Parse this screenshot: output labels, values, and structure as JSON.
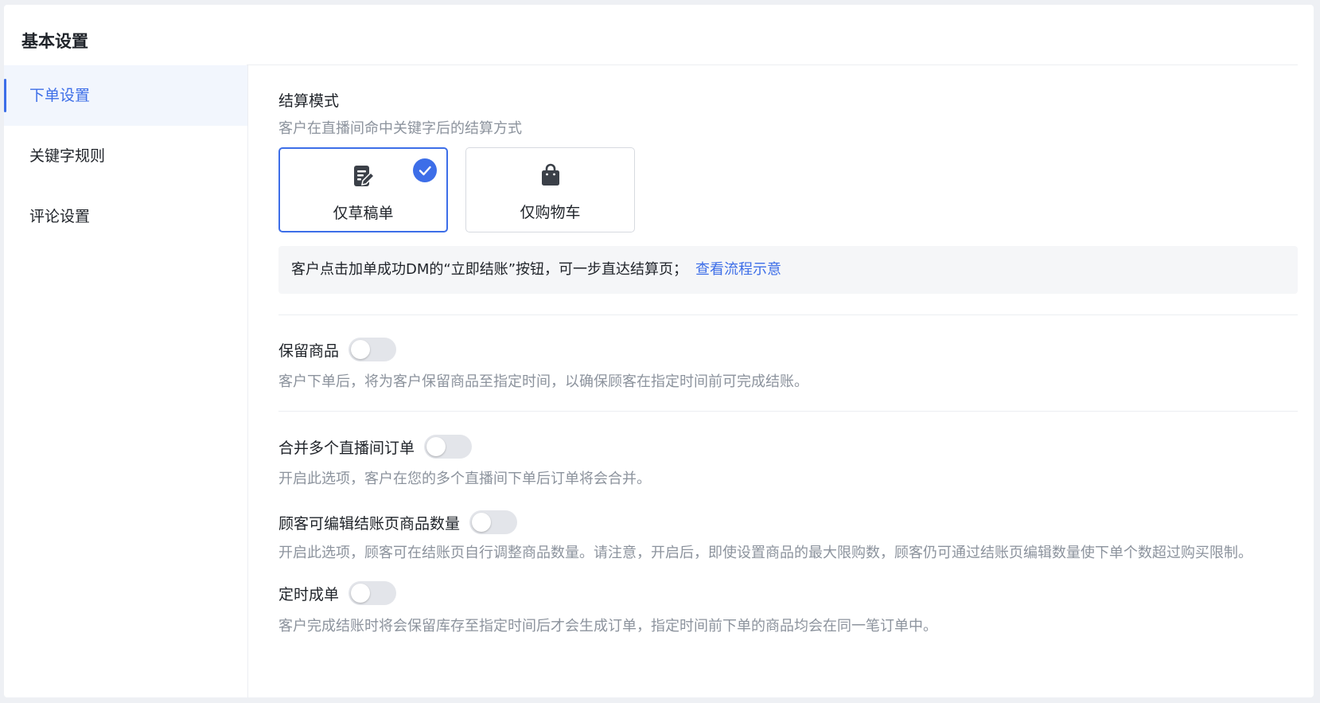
{
  "page": {
    "title": "基本设置"
  },
  "sidebar": {
    "items": [
      {
        "label": "下单设置",
        "active": true
      },
      {
        "label": "关键字规则",
        "active": false
      },
      {
        "label": "评论设置",
        "active": false
      }
    ]
  },
  "checkout_mode": {
    "title": "结算模式",
    "description": "客户在直播间命中关键字后的结算方式",
    "options": [
      {
        "label": "仅草稿单",
        "icon": "edit-document-icon",
        "selected": true
      },
      {
        "label": "仅购物车",
        "icon": "shopping-bag-icon",
        "selected": false
      }
    ],
    "info_text": "客户点击加单成功DM的“立即结账”按钮，可一步直达结算页；",
    "info_link": "查看流程示意"
  },
  "settings": [
    {
      "label": "保留商品",
      "enabled": false,
      "description": "客户下单后，将为客户保留商品至指定时间，以确保顾客在指定时间前可完成结账。"
    },
    {
      "label": "合并多个直播间订单",
      "enabled": false,
      "description": "开启此选项，客户在您的多个直播间下单后订单将会合并。"
    },
    {
      "label": "顾客可编辑结账页商品数量",
      "enabled": false,
      "description": "开启此选项，顾客可在结账页自行调整商品数量。请注意，开启后，即使设置商品的最大限购数，顾客仍可通过结账页编辑数量使下单个数超过购买限制。"
    },
    {
      "label": "定时成单",
      "enabled": false,
      "description": "客户完成结账时将会保留库存至指定时间后才会生成订单，指定时间前下单的商品均会在同一笔订单中。"
    }
  ],
  "colors": {
    "accent": "#3d6ee8",
    "muted_text": "#8c939d",
    "switch_off": "#e3e5ea"
  }
}
